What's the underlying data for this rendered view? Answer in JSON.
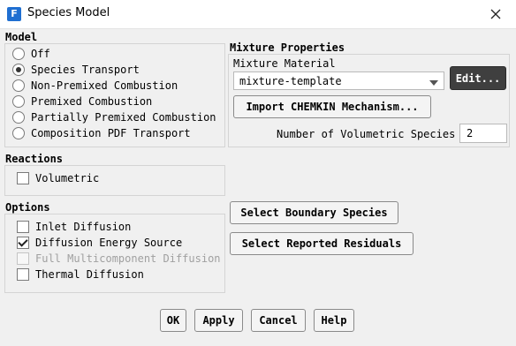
{
  "window": {
    "title": "Species Model",
    "app_icon": "F",
    "close_icon": "close-icon"
  },
  "model": {
    "title": "Model",
    "options": [
      {
        "label": "Off",
        "selected": false
      },
      {
        "label": "Species Transport",
        "selected": true
      },
      {
        "label": "Non-Premixed Combustion",
        "selected": false
      },
      {
        "label": "Premixed Combustion",
        "selected": false
      },
      {
        "label": "Partially Premixed Combustion",
        "selected": false
      },
      {
        "label": "Composition PDF Transport",
        "selected": false
      }
    ]
  },
  "mixture": {
    "title": "Mixture Properties",
    "material_label": "Mixture Material",
    "material_value": "mixture-template",
    "edit_label": "Edit...",
    "import_label": "Import CHEMKIN Mechanism...",
    "num_species_label": "Number of Volumetric Species",
    "num_species_value": "2"
  },
  "reactions": {
    "title": "Reactions",
    "volumetric": {
      "label": "Volumetric",
      "checked": false
    }
  },
  "options": {
    "title": "Options",
    "items": [
      {
        "label": "Inlet Diffusion",
        "checked": false,
        "disabled": false
      },
      {
        "label": "Diffusion Energy Source",
        "checked": true,
        "disabled": false
      },
      {
        "label": "Full Multicomponent Diffusion",
        "checked": false,
        "disabled": true
      },
      {
        "label": "Thermal Diffusion",
        "checked": false,
        "disabled": false
      }
    ]
  },
  "side_buttons": {
    "boundary": "Select Boundary Species",
    "residuals": "Select Reported Residuals"
  },
  "footer": {
    "ok": "OK",
    "apply": "Apply",
    "cancel": "Cancel",
    "help": "Help"
  },
  "colors": {
    "edit_button_bg": "#3f3f3f",
    "app_icon_bg": "#1f6fd1"
  }
}
